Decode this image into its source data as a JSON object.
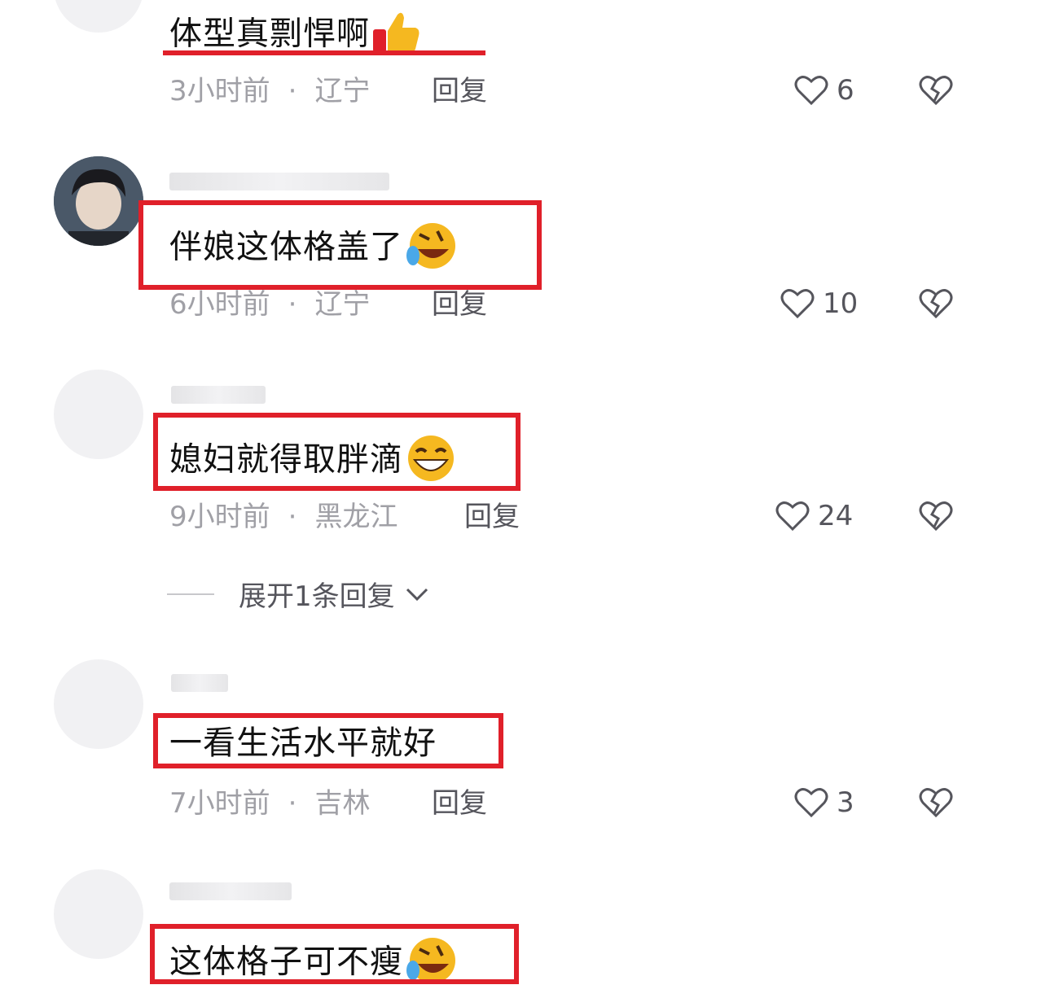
{
  "comments": [
    {
      "text": "体型真剽悍啊",
      "emoji": "thumbs-up-icon",
      "time": "3小时前",
      "region": "辽宁",
      "reply": "回复",
      "likes": "6"
    },
    {
      "text": "伴娘这体格盖了",
      "emoji": "rolling-laughing-icon",
      "time": "6小时前",
      "region": "辽宁",
      "reply": "回复",
      "likes": "10"
    },
    {
      "text": "媳妇就得取胖滴",
      "emoji": "grinning-icon",
      "time": "9小时前",
      "region": "黑龙江",
      "reply": "回复",
      "likes": "24",
      "expand": "展开1条回复"
    },
    {
      "text": "一看生活水平就好",
      "time": "7小时前",
      "region": "吉林",
      "reply": "回复",
      "likes": "3"
    },
    {
      "text": "这体格子可不瘦",
      "emoji": "rolling-laughing-icon"
    }
  ],
  "colors": {
    "highlight": "#e0202a",
    "meta": "#a0a0a6",
    "action": "#55555c"
  }
}
